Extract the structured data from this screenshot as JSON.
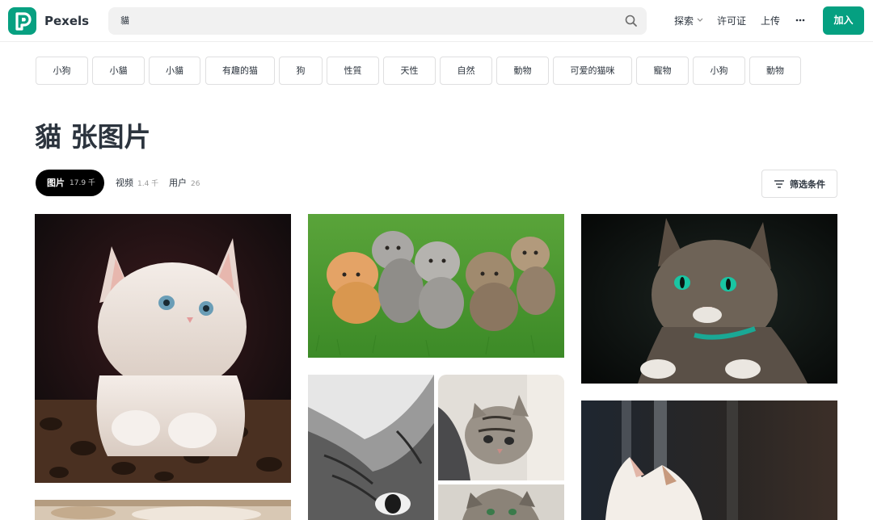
{
  "header": {
    "brand": "Pexels",
    "search_value": "貓",
    "nav": {
      "explore": "探索",
      "license": "许可证",
      "upload": "上传"
    },
    "join_label": "加入"
  },
  "tags": [
    "小狗",
    "小貓",
    "小貓",
    "有趣的猫",
    "狗",
    "性質",
    "天性",
    "自然",
    "動物",
    "可爱的猫咪",
    "寵物",
    "小狗",
    "動物"
  ],
  "page": {
    "title": "貓 张图片"
  },
  "tabs": [
    {
      "label": "图片",
      "count": "17.9 千"
    },
    {
      "label": "视频",
      "count": "1.4 千"
    },
    {
      "label": "用户",
      "count": "26"
    }
  ],
  "filter_label": "筛选条件",
  "colors": {
    "accent": "#05a081",
    "text": "#2c343e",
    "border": "#dfdfe0"
  },
  "photos": [
    {
      "subject": "white kitten on leopard-print bed"
    },
    {
      "subject": "five kittens on grass"
    },
    {
      "subject": "tabby cat with green eyes and teal collar"
    },
    {
      "subject": "black and white cat close-up"
    },
    {
      "subject": "tabby kitten on grey blanket"
    },
    {
      "subject": "tabby kitten"
    },
    {
      "subject": "white cat by window"
    },
    {
      "subject": "cat photo"
    }
  ]
}
